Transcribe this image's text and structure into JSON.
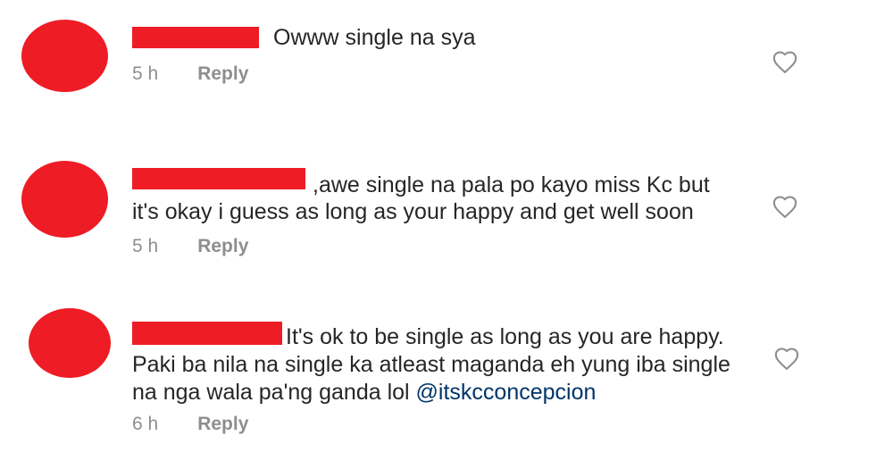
{
  "comments": [
    {
      "text_first": "Owww single na sya",
      "text_rest": [],
      "time": "5 h",
      "reply_label": "Reply"
    },
    {
      "text_first": ",awe single na pala po kayo miss Kc but",
      "text_rest": [
        "it's okay i guess as long as your happy and get well soon"
      ],
      "time": "5 h",
      "reply_label": "Reply"
    },
    {
      "text_first": "It's ok to be single as long as you are happy.",
      "text_rest": [
        "Paki ba nila na single ka atleast maganda eh yung iba single",
        "na nga wala pa'ng ganda lol"
      ],
      "mention": "@itskcconcepcion",
      "time": "6 h",
      "reply_label": "Reply"
    }
  ],
  "icons": {
    "like": "heart-outline-icon"
  },
  "colors": {
    "redaction": "#ee1c25",
    "mention": "#003569",
    "meta": "#8e8e8e"
  }
}
